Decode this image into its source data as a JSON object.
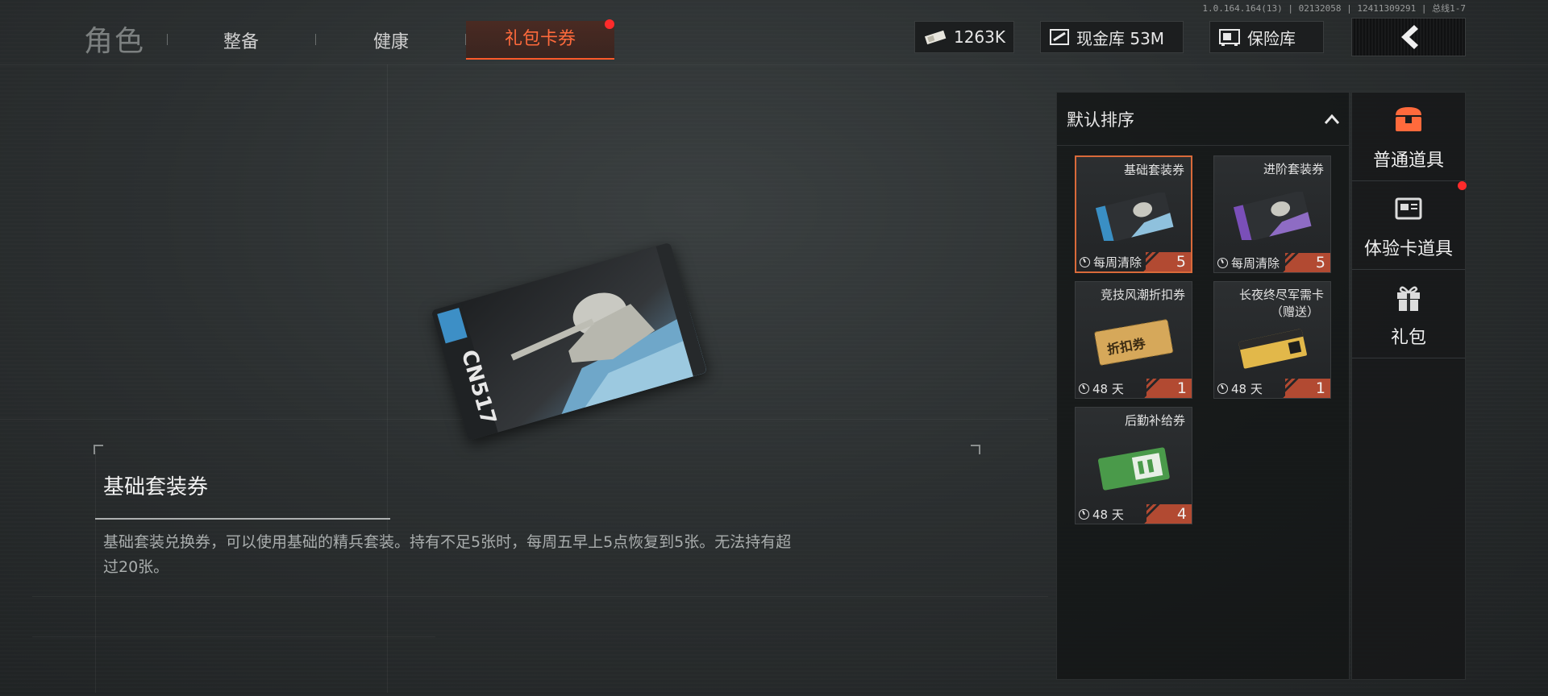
{
  "nav": {
    "role": "角色",
    "tabs": [
      "整备",
      "健康",
      "礼包卡券"
    ]
  },
  "version": "1.0.164.164(13) | 02132058 | 12411309291 | 总线1-7",
  "resources": {
    "currency": "1263K",
    "cash_vault": "现金库 53M",
    "safe": "保险库"
  },
  "selected_item": {
    "card_text": "CN517",
    "name": "基础套装券",
    "description": "基础套装兑换券，可以使用基础的精兵套装。持有不足5张时，每周五早上5点恢复到5张。无法持有超过20张。"
  },
  "panel": {
    "sort_label": "默认排序",
    "items": [
      {
        "name": "基础套装券",
        "expiry": "每周清除",
        "count": "5",
        "accent": "#3a8fc4"
      },
      {
        "name": "进阶套装券",
        "expiry": "每周清除",
        "count": "5",
        "accent": "#7a4fb8"
      },
      {
        "name": "竞技风潮折扣券",
        "expiry": "48 天",
        "count": "1",
        "accent": "#d6a85a",
        "thumb_text": "折扣券"
      },
      {
        "name": "长夜终尽军需卡",
        "sub": "（赠送）",
        "expiry": "48 天",
        "count": "1",
        "accent": "#e2b84a"
      },
      {
        "name": "后勤补给券",
        "expiry": "48 天",
        "count": "4",
        "accent": "#4a9a4a"
      }
    ]
  },
  "categories": [
    {
      "label": "普通道具",
      "icon": "chest-icon",
      "color": "#ff6a3c"
    },
    {
      "label": "体验卡道具",
      "icon": "card-icon",
      "color": "#d8d8d8"
    },
    {
      "label": "礼包",
      "icon": "gift-icon",
      "color": "#d8d8d8"
    }
  ]
}
